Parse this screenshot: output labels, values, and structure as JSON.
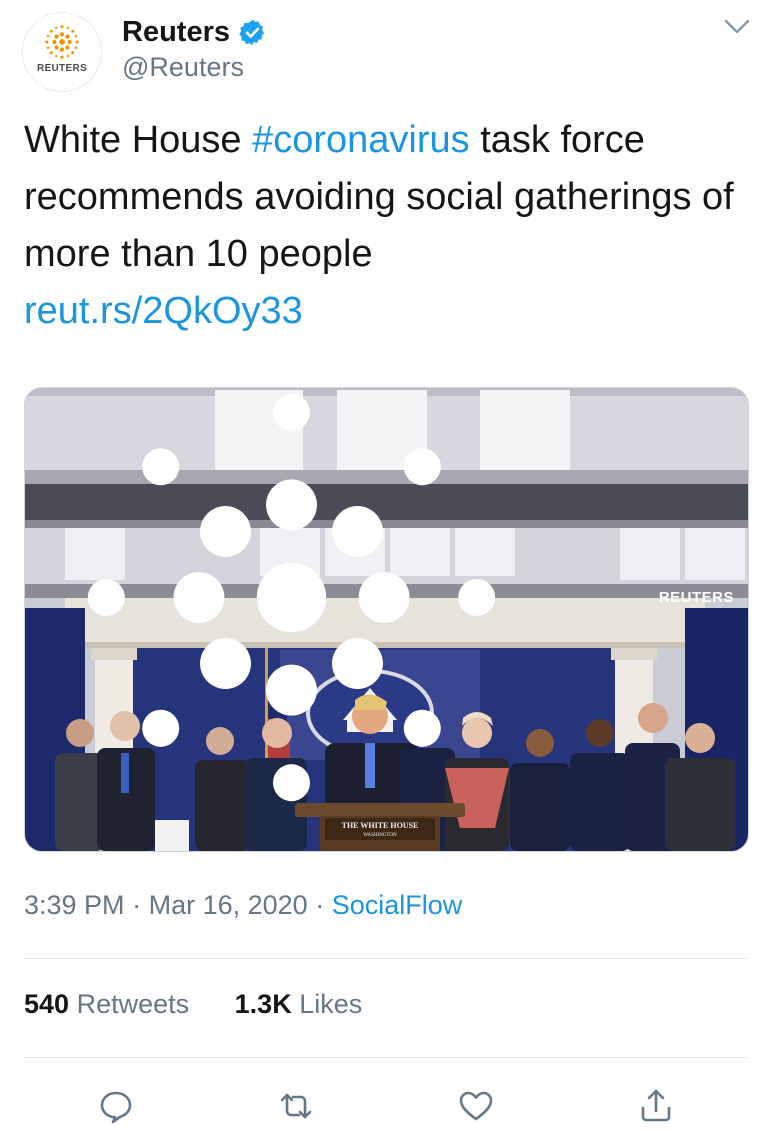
{
  "account": {
    "avatar_label": "REUTERS",
    "display_name": "Reuters",
    "handle": "@Reuters",
    "verified": true
  },
  "tweet": {
    "text_before": "White House ",
    "hashtag": "#coronavirus",
    "text_after": " task force recommends avoiding social gatherings of more than 10 people",
    "link": "reut.rs/2QkOy33"
  },
  "media": {
    "watermark": "REUTERS",
    "podium_sign": "THE WHITE HOUSE",
    "podium_sub": "WASHINGTON"
  },
  "meta": {
    "time": "3:39 PM",
    "separator": "·",
    "date": "Mar 16, 2020",
    "source": "SocialFlow"
  },
  "stats": {
    "retweets_count": "540",
    "retweets_label": "Retweets",
    "likes_count": "1.3K",
    "likes_label": "Likes"
  },
  "actions": {
    "icons": [
      "reply-icon",
      "retweet-icon",
      "like-icon",
      "share-icon"
    ]
  },
  "colors": {
    "link": "#1b95e0",
    "secondary_text": "#657786",
    "primary_text": "#14171a",
    "verified": "#1da1f2",
    "divider": "#e1e8ed"
  }
}
